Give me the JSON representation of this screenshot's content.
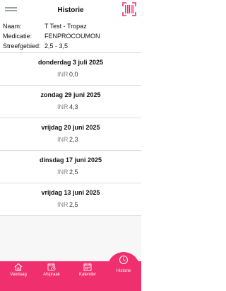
{
  "header": {
    "title": "Historie"
  },
  "patient": {
    "rows": [
      {
        "label": "Naam:",
        "value": "T Test - Tropaz"
      },
      {
        "label": "Medicatie:",
        "value": "FENPROCOUMON"
      },
      {
        "label": "Streefgebied:",
        "value": "2,5 - 3,5"
      }
    ]
  },
  "entries": [
    {
      "date": "donderdag 3 juli 2025",
      "label": "INR",
      "value": "0,0"
    },
    {
      "date": "zondag 29 juni 2025",
      "label": "INR",
      "value": "4,3"
    },
    {
      "date": "vrijdag 20 juni 2025",
      "label": "INR",
      "value": "2,3"
    },
    {
      "date": "dinsdag 17 juni 2025",
      "label": "INR",
      "value": "2,5"
    },
    {
      "date": "vrijdag 13 juni 2025",
      "label": "INR",
      "value": "2,5"
    }
  ],
  "nav": {
    "items": [
      {
        "label": "Vandaag",
        "icon": "home-icon"
      },
      {
        "label": "Afspraak",
        "icon": "calendar-clock-icon"
      },
      {
        "label": "Kalender",
        "icon": "calendar-icon"
      },
      {
        "label": "Historie",
        "icon": "clock-icon"
      }
    ],
    "active": "Historie"
  },
  "colors": {
    "accent": "#ef2f6e"
  }
}
